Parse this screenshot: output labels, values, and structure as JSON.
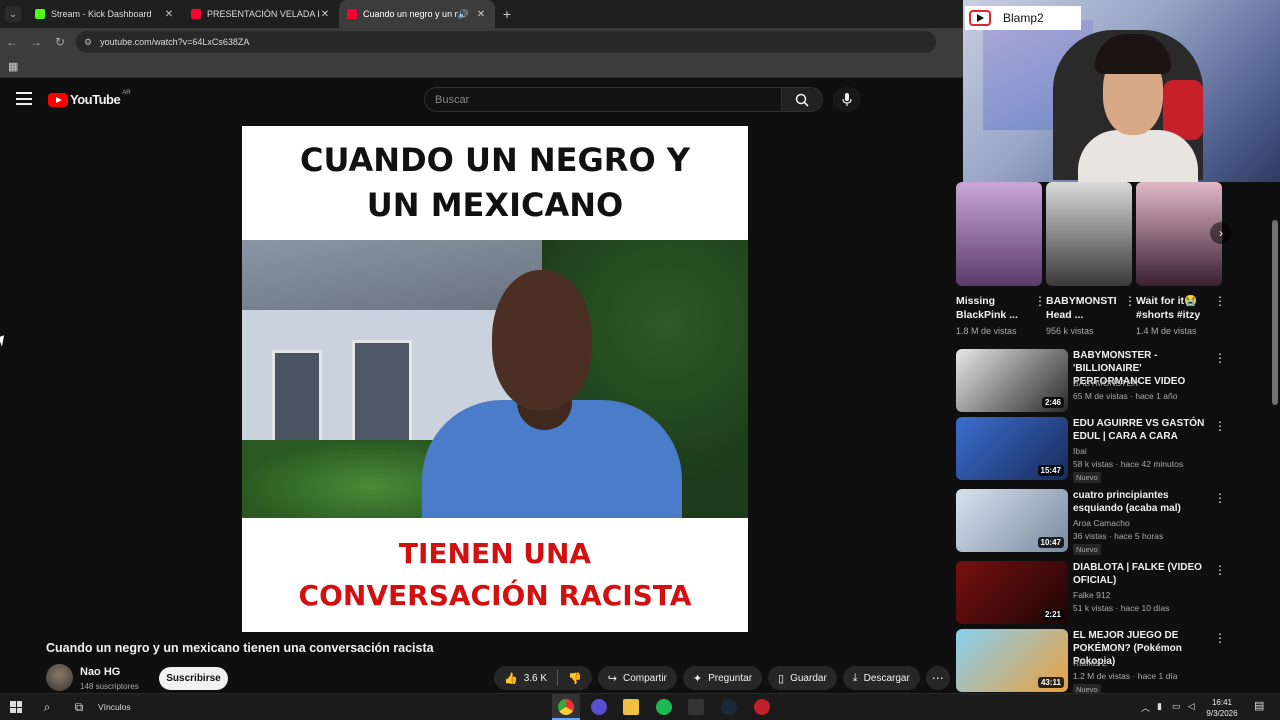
{
  "browser": {
    "tabs": [
      {
        "title": "Stream - Kick Dashboard",
        "favicon_color": "#53fc18",
        "active": false
      },
      {
        "title": "PRESENTACIÓN VELADA DEL AÑ",
        "favicon_color": "#ff0033",
        "active": false
      },
      {
        "title": "Cuando un negro y un mexicano",
        "favicon_color": "#ff0033",
        "active": true
      }
    ],
    "url": "youtube.com/watch?v=64LxCs638ZA"
  },
  "youtube": {
    "logo_text": "YouTube",
    "country": "AR",
    "search_placeholder": "Buscar"
  },
  "video": {
    "caption_top": "CUANDO UN NEGRO Y UN MEXICANO",
    "caption_bottom": "TIENEN UNA CONVERSACIÓN RACISTA",
    "title": "Cuando un negro y un mexicano tienen una conversación racista",
    "channel": "Nao HG",
    "subscribers": "148 suscriptores",
    "subscribe_label": "Suscribirse",
    "likes": "3.6 K",
    "share_label": "Compartir",
    "ask_label": "Preguntar",
    "save_label": "Guardar",
    "download_label": "Descargar"
  },
  "webcam": {
    "name": "Blamp2"
  },
  "shorts": [
    {
      "title": "Missing BlackPink ...",
      "views": "1.8 M de vistas",
      "color_a": "#c9a8d8",
      "color_b": "#5a3a6a"
    },
    {
      "title": "BABYMONSTER Head ...",
      "views": "956 k vistas",
      "color_a": "#d8d8d8",
      "color_b": "#3a3a3a"
    },
    {
      "title": "Wait for it😭 #shorts #itzy",
      "views": "1.4 M de vistas",
      "color_a": "#e0b8c8",
      "color_b": "#3a2030"
    }
  ],
  "recommendations": [
    {
      "title": "BABYMONSTER - 'BILLIONAIRE' PERFORMANCE VIDEO",
      "channel": "BABYMONSTER",
      "meta": "65 M de vistas · hace 1 año",
      "duration": "2:46",
      "badge": "",
      "color_a": "#e8e8e8",
      "color_b": "#2a2a2a"
    },
    {
      "title": "EDU AGUIRRE VS GASTÓN EDUL | CARA A CARA",
      "channel": "Ibai",
      "meta": "58 k vistas · hace 42 minutos",
      "duration": "15:47",
      "badge": "Nuevo",
      "color_a": "#3b6fd0",
      "color_b": "#1a2a5a"
    },
    {
      "title": "cuatro principiantes esquiando (acaba mal)",
      "channel": "Aroa Camacho",
      "meta": "36 vistas · hace 5 horas",
      "duration": "10:47",
      "badge": "Nuevo",
      "color_a": "#d8e2ee",
      "color_b": "#7a8aa0"
    },
    {
      "title": "DIABLOTA | FALKE (VIDEO OFICIAL)",
      "channel": "Falke 912",
      "meta": "51 k vistas · hace 10 días",
      "duration": "2:21",
      "badge": "",
      "color_a": "#7a1010",
      "color_b": "#1a0505"
    },
    {
      "title": "EL MEJOR JUEGO DE POKÉMON? (Pokémon Pokopia)",
      "channel": "Rubius Z",
      "meta": "1.2 M de vistas · hace 1 día",
      "duration": "43:11",
      "badge": "Nuevo",
      "color_a": "#8ad0f0",
      "color_b": "#e8a040"
    }
  ],
  "taskbar": {
    "search_text": "Vínculos",
    "time": "16:41",
    "date": "9/3/2026"
  }
}
